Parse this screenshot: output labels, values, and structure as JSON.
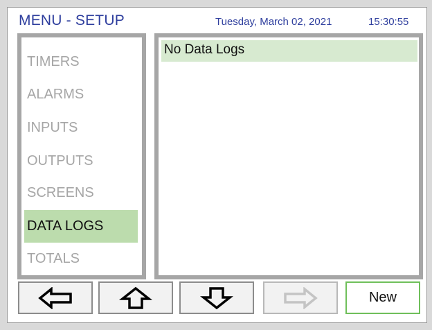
{
  "header": {
    "title": "MENU - SETUP",
    "date": "Tuesday, March 02, 2021",
    "time": "15:30:55"
  },
  "sidebar": {
    "items": [
      {
        "label": "TIMERS",
        "active": false
      },
      {
        "label": "ALARMS",
        "active": false
      },
      {
        "label": "INPUTS",
        "active": false
      },
      {
        "label": "OUTPUTS",
        "active": false
      },
      {
        "label": "SCREENS",
        "active": false
      },
      {
        "label": "DATA LOGS",
        "active": true
      },
      {
        "label": "TOTALS",
        "active": false
      }
    ]
  },
  "main": {
    "list_items": [
      "No Data Logs"
    ]
  },
  "toolbar": {
    "buttons": [
      {
        "icon": "arrow-left-icon",
        "enabled": true
      },
      {
        "icon": "arrow-up-icon",
        "enabled": true
      },
      {
        "icon": "arrow-down-icon",
        "enabled": true
      },
      {
        "icon": "arrow-right-icon",
        "enabled": false
      },
      {
        "label": "New",
        "enabled": true
      }
    ]
  },
  "colors": {
    "title_text": "#2f3f9e",
    "active_item_bg": "#bcdcad",
    "list_row_bg": "#d7ead0",
    "inactive_text": "#a6a6a6",
    "new_button_border": "#6fbf5a"
  }
}
